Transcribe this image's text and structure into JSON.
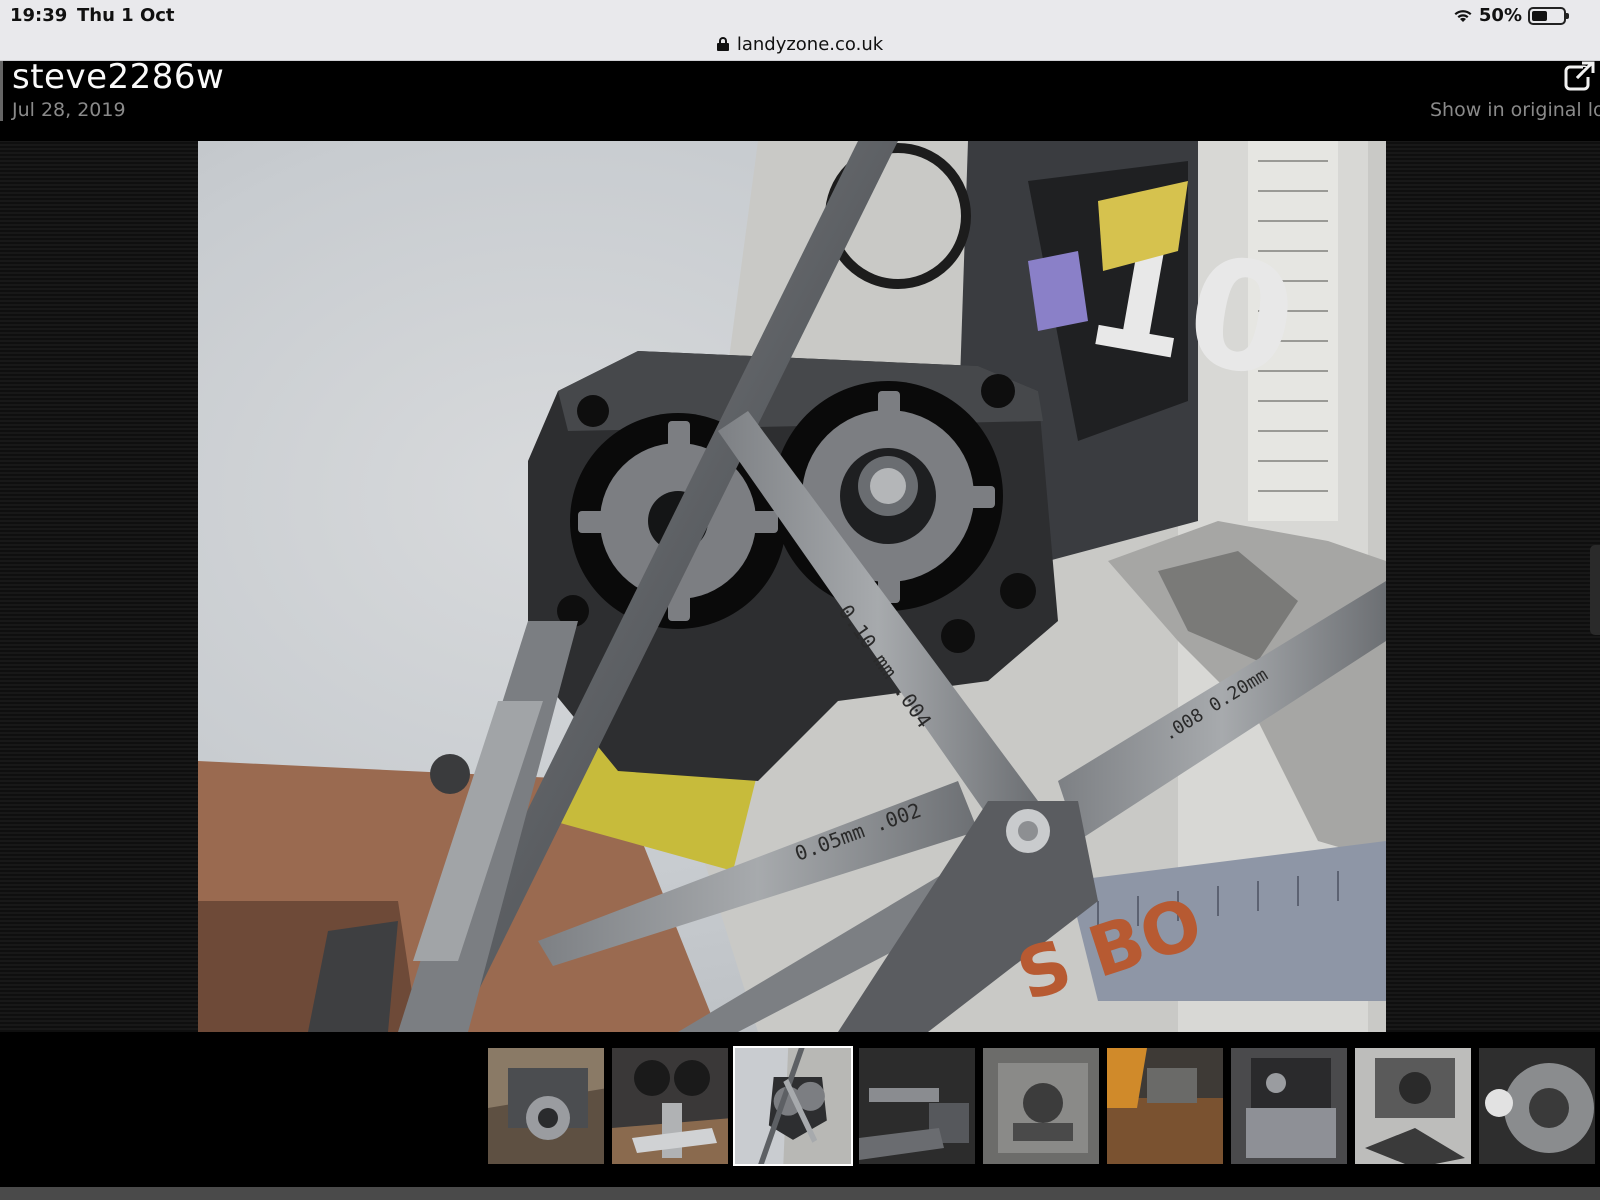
{
  "status_bar": {
    "time": "19:39",
    "date": "Thu 1 Oct",
    "battery": "50%",
    "battery_level": 0.5
  },
  "browser": {
    "url": "landyzone.co.uk"
  },
  "lightbox": {
    "username": "steve2286w",
    "date": "Jul 28, 2019",
    "show_original": "Show in original lo",
    "icons": {
      "external": "external-link-icon",
      "lock": "lock-icon",
      "wifi": "wifi-icon",
      "battery": "battery-icon"
    }
  },
  "thumbnails": {
    "count": 9,
    "active_index": 2
  },
  "colors": {
    "status_bar_bg": "#e9e9ec",
    "background": "#000000",
    "muted_text": "#8a8a8a",
    "active_border": "#ffffff"
  }
}
